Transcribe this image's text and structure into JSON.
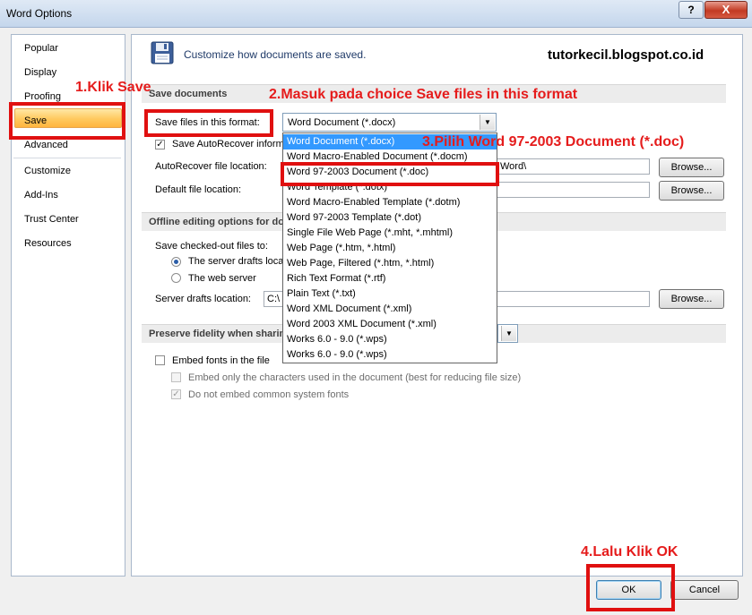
{
  "window": {
    "title": "Word Options",
    "help_label": "?",
    "close_label": "X"
  },
  "sidebar": {
    "items": [
      {
        "label": "Popular"
      },
      {
        "label": "Display"
      },
      {
        "label": "Proofing"
      },
      {
        "label": "Save"
      },
      {
        "label": "Advanced"
      },
      {
        "label": "Customize"
      },
      {
        "label": "Add-Ins"
      },
      {
        "label": "Trust Center"
      },
      {
        "label": "Resources"
      }
    ],
    "selected": "Save"
  },
  "header": {
    "text": "Customize how documents are saved.",
    "icon": "floppy-disk-icon"
  },
  "watermark": "tutorkecil.blogspot.co.id",
  "save_documents": {
    "section_title": "Save documents",
    "format_label": "Save files in this format:",
    "format_value": "Word Document (*.docx)",
    "autorecover_checkbox_label": "Save AutoRecover inform",
    "autorecover_checked": true,
    "autorecover_location_label": "AutoRecover file location:",
    "autorecover_location_value": "Word\\",
    "default_location_label": "Default file location:",
    "default_location_value": "",
    "browse_label": "Browse..."
  },
  "format_dropdown": {
    "items": [
      "Word Document (*.docx)",
      "Word Macro-Enabled Document (*.docm)",
      "Word 97-2003 Document (*.doc)",
      "Word Template (*.dotx)",
      "Word Macro-Enabled Template (*.dotm)",
      "Word 97-2003 Template (*.dot)",
      "Single File Web Page (*.mht, *.mhtml)",
      "Web Page (*.htm, *.html)",
      "Web Page, Filtered (*.htm, *.html)",
      "Rich Text Format (*.rtf)",
      "Plain Text (*.txt)",
      "Word XML Document (*.xml)",
      "Word 2003 XML Document (*.xml)",
      "Works 6.0 - 9.0 (*.wps)",
      "Works 6.0 - 9.0 (*.wps)"
    ],
    "selected_index": 0
  },
  "offline": {
    "section_title": "Offline editing options for do",
    "checked_out_label": "Save checked-out files to:",
    "radio_server": "The server drafts loca",
    "radio_web": "The web server",
    "server_drafts_label": "Server drafts location:",
    "server_drafts_value": "C:\\",
    "browse_label": "Browse..."
  },
  "fidelity": {
    "section_title": "Preserve fidelity when sharin",
    "embed_fonts_label": "Embed fonts in the file",
    "embed_chars_label": "Embed only the characters used in the document (best for reducing file size)",
    "no_system_fonts_label": "Do not embed common system fonts"
  },
  "buttons": {
    "ok": "OK",
    "cancel": "Cancel"
  },
  "annotations": {
    "step1": "1.Klik Save",
    "step2": "2.Masuk pada choice Save files in this format",
    "step3": "3.Pilih Word 97-2003 Document (*.doc)",
    "step4": "4.Lalu Klik OK"
  },
  "colors": {
    "annotation": "#e51c1c",
    "selection_highlight": "#3399ff",
    "sidebar_selected": "#ffc95e",
    "close_button": "#c33a23"
  }
}
